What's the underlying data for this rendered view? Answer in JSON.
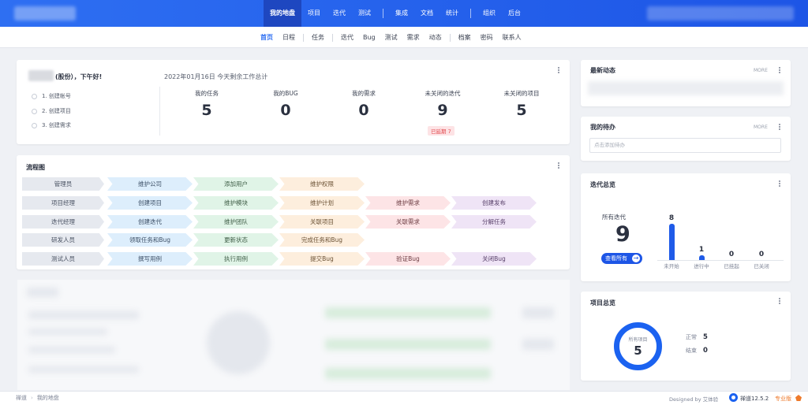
{
  "topbar": {
    "nav": [
      "我的地盘",
      "项目",
      "迭代",
      "测试",
      "集成",
      "文档",
      "统计",
      "组织",
      "后台"
    ]
  },
  "subnav": [
    "首页",
    "日程",
    "任务",
    "迭代",
    "Bug",
    "测试",
    "需求",
    "动态",
    "档案",
    "密码",
    "联系人"
  ],
  "welcome": {
    "greeting": "(股份），下午好!",
    "steps": [
      "1. 创建帐号",
      "2. 创建项目",
      "3. 创建需求"
    ],
    "date_text": "2022年01月16日   今天剩余工作总计",
    "stats": [
      {
        "label": "我的任务",
        "value": "5"
      },
      {
        "label": "我的BUG",
        "value": "0"
      },
      {
        "label": "我的需求",
        "value": "0"
      },
      {
        "label": "未关闭的迭代",
        "value": "9"
      },
      {
        "label": "未关闭的项目",
        "value": "5"
      }
    ],
    "overdue": "已延期 7"
  },
  "flow": {
    "title": "流程图",
    "rows": [
      {
        "role": "管理员",
        "steps": [
          "维护公司",
          "添加用户",
          "维护权限"
        ]
      },
      {
        "role": "项目经理",
        "steps": [
          "创建项目",
          "维护模块",
          "维护计划",
          "维护需求",
          "创建发布"
        ]
      },
      {
        "role": "迭代经理",
        "steps": [
          "创建迭代",
          "维护团队",
          "关联项目",
          "关联需求",
          "分解任务"
        ]
      },
      {
        "role": "研发人员",
        "steps": [
          "领取任务和Bug",
          "更新状态",
          "完成任务和Bug"
        ]
      },
      {
        "role": "测试人员",
        "steps": [
          "撰写用例",
          "执行用例",
          "提交Bug",
          "验证Bug",
          "关闭Bug"
        ]
      }
    ]
  },
  "news": {
    "title": "最新动态",
    "more": "MORE"
  },
  "todo": {
    "title": "我的待办",
    "more": "MORE",
    "placeholder": "点击添加待办"
  },
  "iteration": {
    "title": "迭代总览",
    "all_label": "所有迭代",
    "all_value": "9",
    "view_all": "查看所有",
    "chart_data": {
      "type": "bar",
      "categories": [
        "未开始",
        "进行中",
        "已挂起",
        "已关闭"
      ],
      "values": [
        8,
        1,
        0,
        0
      ],
      "ylim": [
        0,
        8
      ],
      "color": "#1f5be8"
    }
  },
  "project": {
    "title": "项目总览",
    "ring_label": "所有项目",
    "ring_value": "5",
    "legend": [
      {
        "label": "正常",
        "value": "5"
      },
      {
        "label": "结束",
        "value": "0"
      }
    ],
    "ring_color": "#1b62f0"
  },
  "footer": {
    "crumbs": [
      "禅道",
      "我的地盘"
    ],
    "designed": "Designed by 艾体验",
    "brand": "禅道12.5.2",
    "edition": "专业版"
  }
}
